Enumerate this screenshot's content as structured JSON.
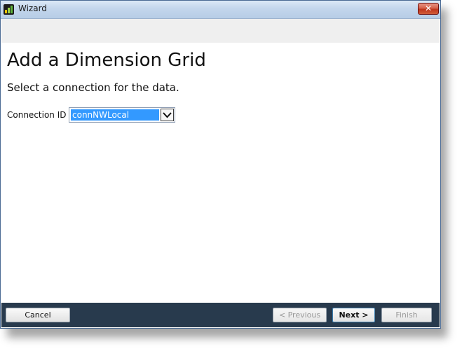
{
  "window": {
    "title": "Wizard",
    "close_symbol": "✕"
  },
  "page": {
    "title": "Add a Dimension Grid",
    "subtitle": "Select a connection for the data."
  },
  "connection": {
    "label": "Connection ID",
    "selected": "connNWLocal"
  },
  "footer": {
    "cancel": "Cancel",
    "previous": "< Previous",
    "next": "Next >",
    "finish": "Finish"
  },
  "icons": {
    "app": "bar-chart-icon",
    "close": "close-icon",
    "dropdown": "chevron-down-icon"
  },
  "colors": {
    "footer_bg": "#283a4d",
    "selection": "#3399ff",
    "close_red": "#c0361d"
  }
}
